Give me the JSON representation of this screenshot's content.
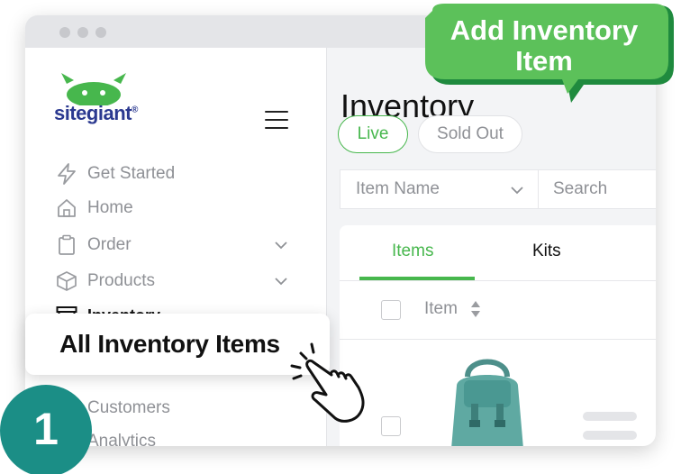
{
  "callout": {
    "label": "Add Inventory Item"
  },
  "step_badge": {
    "number": "1"
  },
  "brand": {
    "site": "site",
    "giant": "giant"
  },
  "colors": {
    "brand_green": "#47b74d",
    "brand_navy": "#2b3990",
    "teal": "#1b8e86",
    "callout_green": "#5cc15a"
  },
  "sidebar": {
    "items": [
      {
        "label": "Get Started",
        "icon": "lightning-icon"
      },
      {
        "label": "Home",
        "icon": "home-icon"
      },
      {
        "label": "Order",
        "icon": "clipboard-icon"
      },
      {
        "label": "Products",
        "icon": "box-icon"
      },
      {
        "label": "Inventory",
        "icon": "archive-icon"
      },
      {
        "label": "Customers",
        "icon": "users-icon"
      },
      {
        "label": "Analytics",
        "icon": "chart-icon"
      }
    ],
    "submenu": {
      "active_label": "All Inventory Items"
    }
  },
  "main": {
    "title": "Inventory",
    "status_tabs": [
      {
        "label": "Live",
        "selected": true
      },
      {
        "label": "Sold Out",
        "selected": false
      }
    ],
    "filter": {
      "field_select": "Item Name",
      "search_placeholder": "Search"
    },
    "table_tabs": [
      {
        "label": "Items",
        "selected": true
      },
      {
        "label": "Kits",
        "selected": false
      }
    ],
    "columns": [
      "Item"
    ]
  }
}
